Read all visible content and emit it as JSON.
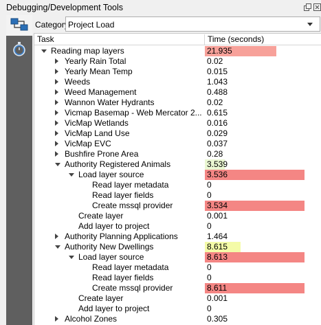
{
  "window": {
    "title": "Debugging/Development Tools"
  },
  "leftbar": {
    "items": [
      {
        "name": "network-logger-icon"
      },
      {
        "name": "profiler-stopwatch-icon"
      }
    ]
  },
  "category": {
    "label": "Category",
    "value": "Project Load"
  },
  "table": {
    "headers": [
      "Task",
      "Time (seconds)"
    ],
    "rows": [
      {
        "depth": 0,
        "expander": "open",
        "task": "Reading map layers",
        "time": "21.935",
        "color": "#f7a19a",
        "bar": 0.72
      },
      {
        "depth": 1,
        "expander": "closed",
        "task": "Yearly Rain Total",
        "time": "0.02",
        "color": "",
        "bar": 0
      },
      {
        "depth": 1,
        "expander": "closed",
        "task": "Yearly Mean Temp",
        "time": "0.015",
        "color": "",
        "bar": 0
      },
      {
        "depth": 1,
        "expander": "closed",
        "task": "Weeds",
        "time": "1.043",
        "color": "",
        "bar": 0
      },
      {
        "depth": 1,
        "expander": "closed",
        "task": "Weed Management",
        "time": "0.488",
        "color": "",
        "bar": 0
      },
      {
        "depth": 1,
        "expander": "closed",
        "task": "Wannon Water Hydrants",
        "time": "0.02",
        "color": "",
        "bar": 0
      },
      {
        "depth": 1,
        "expander": "closed",
        "task": "Vicmap Basemap - Web Mercator 2...",
        "time": "0.615",
        "color": "",
        "bar": 0
      },
      {
        "depth": 1,
        "expander": "closed",
        "task": "VicMap Wetlands",
        "time": "0.016",
        "color": "",
        "bar": 0
      },
      {
        "depth": 1,
        "expander": "closed",
        "task": "VicMap Land Use",
        "time": "0.029",
        "color": "",
        "bar": 0
      },
      {
        "depth": 1,
        "expander": "closed",
        "task": "VicMap EVC",
        "time": "0.037",
        "color": "",
        "bar": 0
      },
      {
        "depth": 1,
        "expander": "closed",
        "task": "Bushfire Prone Area",
        "time": "0.28",
        "color": "",
        "bar": 0
      },
      {
        "depth": 1,
        "expander": "open",
        "task": "Authority Registered Animals",
        "time": "3.539",
        "color": "#eaf7d2",
        "bar": 0.2
      },
      {
        "depth": 2,
        "expander": "open",
        "task": "Load layer source",
        "time": "3.536",
        "color": "#f48684",
        "bar": 1.0
      },
      {
        "depth": 3,
        "expander": "",
        "task": "Read layer metadata",
        "time": "0",
        "color": "",
        "bar": 0
      },
      {
        "depth": 3,
        "expander": "",
        "task": "Read layer fields",
        "time": "0",
        "color": "",
        "bar": 0
      },
      {
        "depth": 3,
        "expander": "",
        "task": "Create mssql provider",
        "time": "3.534",
        "color": "#f48684",
        "bar": 1.0
      },
      {
        "depth": 2,
        "expander": "",
        "task": "Create layer",
        "time": "0.001",
        "color": "",
        "bar": 0
      },
      {
        "depth": 2,
        "expander": "",
        "task": "Add layer to project",
        "time": "0",
        "color": "",
        "bar": 0
      },
      {
        "depth": 1,
        "expander": "closed",
        "task": "Authority Planning Applications",
        "time": "1.464",
        "color": "",
        "bar": 0
      },
      {
        "depth": 1,
        "expander": "open",
        "task": "Authority New Dwellings",
        "time": "8.615",
        "color": "#f4fba8",
        "bar": 0.36
      },
      {
        "depth": 2,
        "expander": "open",
        "task": "Load layer source",
        "time": "8.613",
        "color": "#f48684",
        "bar": 1.0
      },
      {
        "depth": 3,
        "expander": "",
        "task": "Read layer metadata",
        "time": "0",
        "color": "",
        "bar": 0
      },
      {
        "depth": 3,
        "expander": "",
        "task": "Read layer fields",
        "time": "0",
        "color": "",
        "bar": 0
      },
      {
        "depth": 3,
        "expander": "",
        "task": "Create mssql provider",
        "time": "8.611",
        "color": "#f48684",
        "bar": 1.0
      },
      {
        "depth": 2,
        "expander": "",
        "task": "Create layer",
        "time": "0.001",
        "color": "",
        "bar": 0
      },
      {
        "depth": 2,
        "expander": "",
        "task": "Add layer to project",
        "time": "0",
        "color": "",
        "bar": 0
      },
      {
        "depth": 1,
        "expander": "closed",
        "task": "Alcohol Zones",
        "time": "0.305",
        "color": "",
        "bar": 0
      }
    ]
  }
}
